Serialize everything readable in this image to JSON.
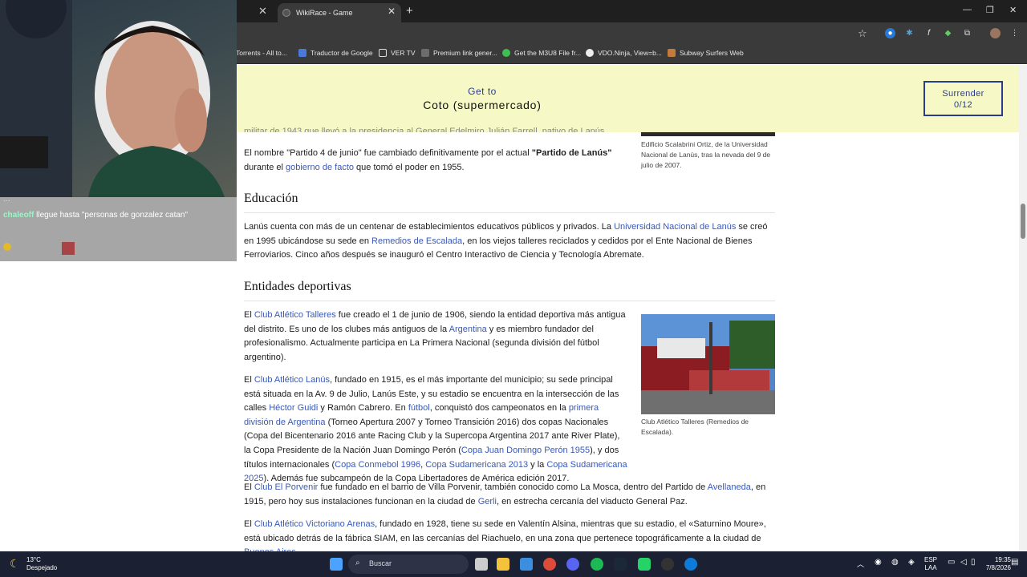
{
  "browser": {
    "tab_title": "WikiRace - Game",
    "bookmarks": [
      "Torrents - All to...",
      "Traductor de Google",
      "VER TV",
      "Premium link gener...",
      "Get the M3U8 File fr...",
      "VDO.Ninja, View=b...",
      "Subway Surfers Web"
    ]
  },
  "game": {
    "get_to_label": "Get to",
    "target_article": "Coto (supermercado)",
    "surrender_label": "Surrender",
    "surrender_count": "0/12"
  },
  "article": {
    "top_partial_text": "militar de 1943 que llevó a la presidencia al General Edelmiro Julián Farrell, nativo de Lanús.",
    "p_partido": "El nombre \"Partido 4 de junio\" fue cambiado definitivamente por el actual \"Partido de Lanús\" durante el gobierno de facto que tomó el poder en 1955.",
    "caption_top": "Edificio Scalabrini Ortiz, de la Universidad Nacional de Lanús, tras la nevada del 9 de julio de 2007.",
    "h_educacion": "Educación",
    "h_deportes": "Entidades deportivas",
    "caption_club": "Club Atlético Talleres (Remedios de Escalada)."
  },
  "chat": {
    "line1_user": "chaleoff",
    "line1_text": "llegue hasta \"personas de gonzalez catan\""
  },
  "taskbar": {
    "weather_temp": "13°C",
    "weather_desc": "Despejado",
    "search_placeholder": "Buscar",
    "lang": "ESP",
    "lang2": "LAA",
    "time": "19:35",
    "date": "7/8/2026"
  }
}
